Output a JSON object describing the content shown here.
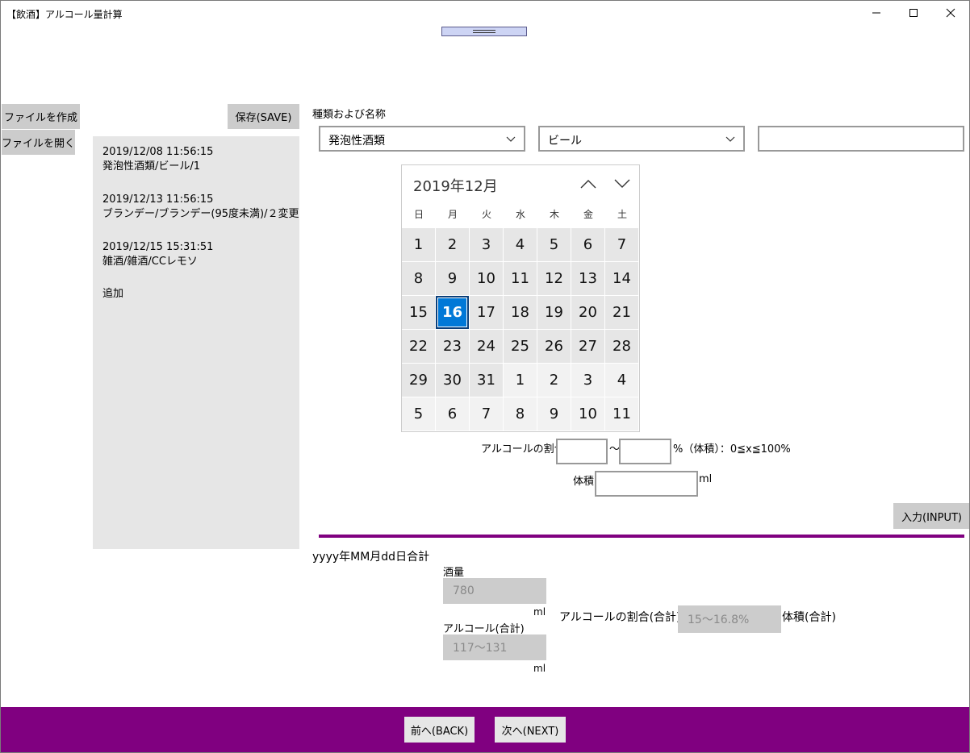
{
  "window": {
    "title": "【飲酒】アルコール量計算"
  },
  "sidebar": {
    "create_file": "ファイルを作成",
    "open_file": "ファイルを開く"
  },
  "list": {
    "save_label": "保存(SAVE)",
    "items": [
      {
        "date": "2019/12/08 11:56:15",
        "desc": "発泡性酒類/ビール/1"
      },
      {
        "date": "2019/12/13 11:56:15",
        "desc": "ブランデー/ブランデー(95度未満)/２変更"
      },
      {
        "date": "2019/12/15 15:31:51",
        "desc": "雑酒/雑酒/CCレモソ"
      }
    ],
    "add_label": "追加"
  },
  "form": {
    "category_label": "種類および名称",
    "category_value": "発泡性酒類",
    "type_value": "ビール",
    "name_value": "",
    "alcohol_label": "アルコールの割合",
    "range_sep": "～",
    "range_hint": "%（体積）：0≦x≦100%",
    "volume_label": "体積",
    "volume_unit": "ml",
    "input_label": "入力(INPUT)"
  },
  "calendar": {
    "header": "2019年12月",
    "weekdays": [
      "日",
      "月",
      "火",
      "水",
      "木",
      "金",
      "土"
    ],
    "selected_day": "16",
    "days": [
      "1",
      "2",
      "3",
      "4",
      "5",
      "6",
      "7",
      "8",
      "9",
      "10",
      "11",
      "12",
      "13",
      "14",
      "15",
      "16",
      "17",
      "18",
      "19",
      "20",
      "21",
      "22",
      "23",
      "24",
      "25",
      "26",
      "27",
      "28",
      "29",
      "30",
      "31",
      "1",
      "2",
      "3",
      "4",
      "5",
      "6",
      "7",
      "8",
      "9",
      "10",
      "11"
    ]
  },
  "summary": {
    "title": "yyyy年MM月dd日合計",
    "liquor_label": "酒量",
    "liquor_value": "780",
    "liquor_unit": "ml",
    "alcohol_total_label": "アルコール(合計)",
    "alcohol_total_value": "117～131",
    "alcohol_total_unit": "ml",
    "ratio_total_label": "アルコールの割合(合計)",
    "ratio_total_value": "15～16.8%",
    "volume_total_label": "体積(合計)"
  },
  "footer": {
    "back_label": "前へ(BACK)",
    "next_label": "次へ(NEXT)"
  },
  "colors": {
    "accent": "#800080",
    "selected": "#0078d7",
    "panel": "#e6e6e6",
    "button": "#cccccc"
  }
}
